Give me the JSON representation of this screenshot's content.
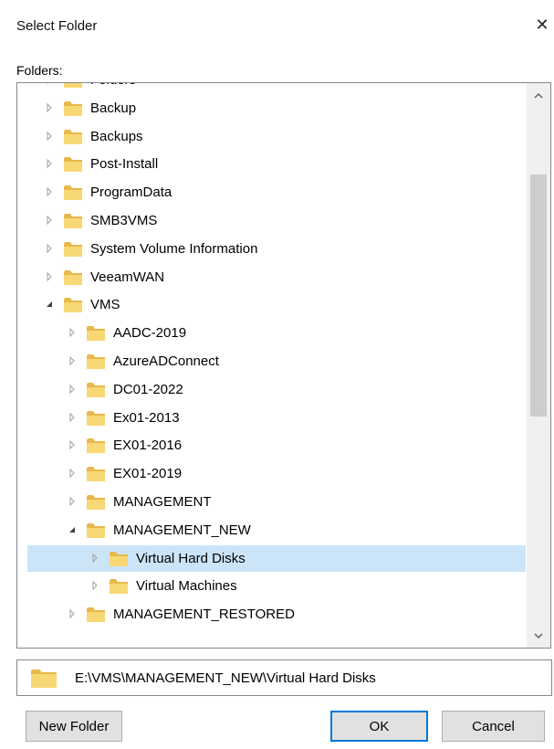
{
  "dialog": {
    "title": "Select Folder",
    "close_glyph": "✕"
  },
  "folders_label": "Folders:",
  "tree": {
    "items": [
      {
        "label": "Folders",
        "level": 1,
        "expanded": false,
        "icon": "folder-icon",
        "partially_visible": true
      },
      {
        "label": "Backup",
        "level": 1,
        "expanded": false,
        "icon": "folder-icon"
      },
      {
        "label": "Backups",
        "level": 1,
        "expanded": false,
        "icon": "folder-icon"
      },
      {
        "label": "Post-Install",
        "level": 1,
        "expanded": false,
        "icon": "folder-icon"
      },
      {
        "label": "ProgramData",
        "level": 1,
        "expanded": false,
        "icon": "folder-icon"
      },
      {
        "label": "SMB3VMS",
        "level": 1,
        "expanded": false,
        "icon": "folder-icon"
      },
      {
        "label": "System Volume Information",
        "level": 1,
        "expanded": false,
        "icon": "folder-icon"
      },
      {
        "label": "VeeamWAN",
        "level": 1,
        "expanded": false,
        "icon": "folder-icon"
      },
      {
        "label": "VMS",
        "level": 1,
        "expanded": true,
        "icon": "folder-icon"
      },
      {
        "label": "AADC-2019",
        "level": 2,
        "expanded": false,
        "icon": "folder-icon"
      },
      {
        "label": "AzureADConnect",
        "level": 2,
        "expanded": false,
        "icon": "folder-icon"
      },
      {
        "label": "DC01-2022",
        "level": 2,
        "expanded": false,
        "icon": "folder-icon"
      },
      {
        "label": "Ex01-2013",
        "level": 2,
        "expanded": false,
        "icon": "folder-icon"
      },
      {
        "label": "EX01-2016",
        "level": 2,
        "expanded": false,
        "icon": "folder-icon"
      },
      {
        "label": "EX01-2019",
        "level": 2,
        "expanded": false,
        "icon": "folder-icon"
      },
      {
        "label": "MANAGEMENT",
        "level": 2,
        "expanded": false,
        "icon": "folder-icon"
      },
      {
        "label": "MANAGEMENT_NEW",
        "level": 2,
        "expanded": true,
        "icon": "folder-icon"
      },
      {
        "label": "Virtual Hard Disks",
        "level": 3,
        "expanded": false,
        "selected": true,
        "icon": "folder-icon"
      },
      {
        "label": "Virtual Machines",
        "level": 3,
        "expanded": false,
        "icon": "folder-icon"
      },
      {
        "label": "MANAGEMENT_RESTORED",
        "level": 2,
        "expanded": false,
        "icon": "folder-icon"
      }
    ]
  },
  "path": {
    "value": "E:\\VMS\\MANAGEMENT_NEW\\Virtual Hard Disks",
    "icon": "folder-icon"
  },
  "buttons": {
    "new_folder": "New Folder",
    "ok": "OK",
    "cancel": "Cancel"
  },
  "colors": {
    "selection": "#cce4f7",
    "folder": "#f8d775",
    "accent": "#0078d7"
  }
}
